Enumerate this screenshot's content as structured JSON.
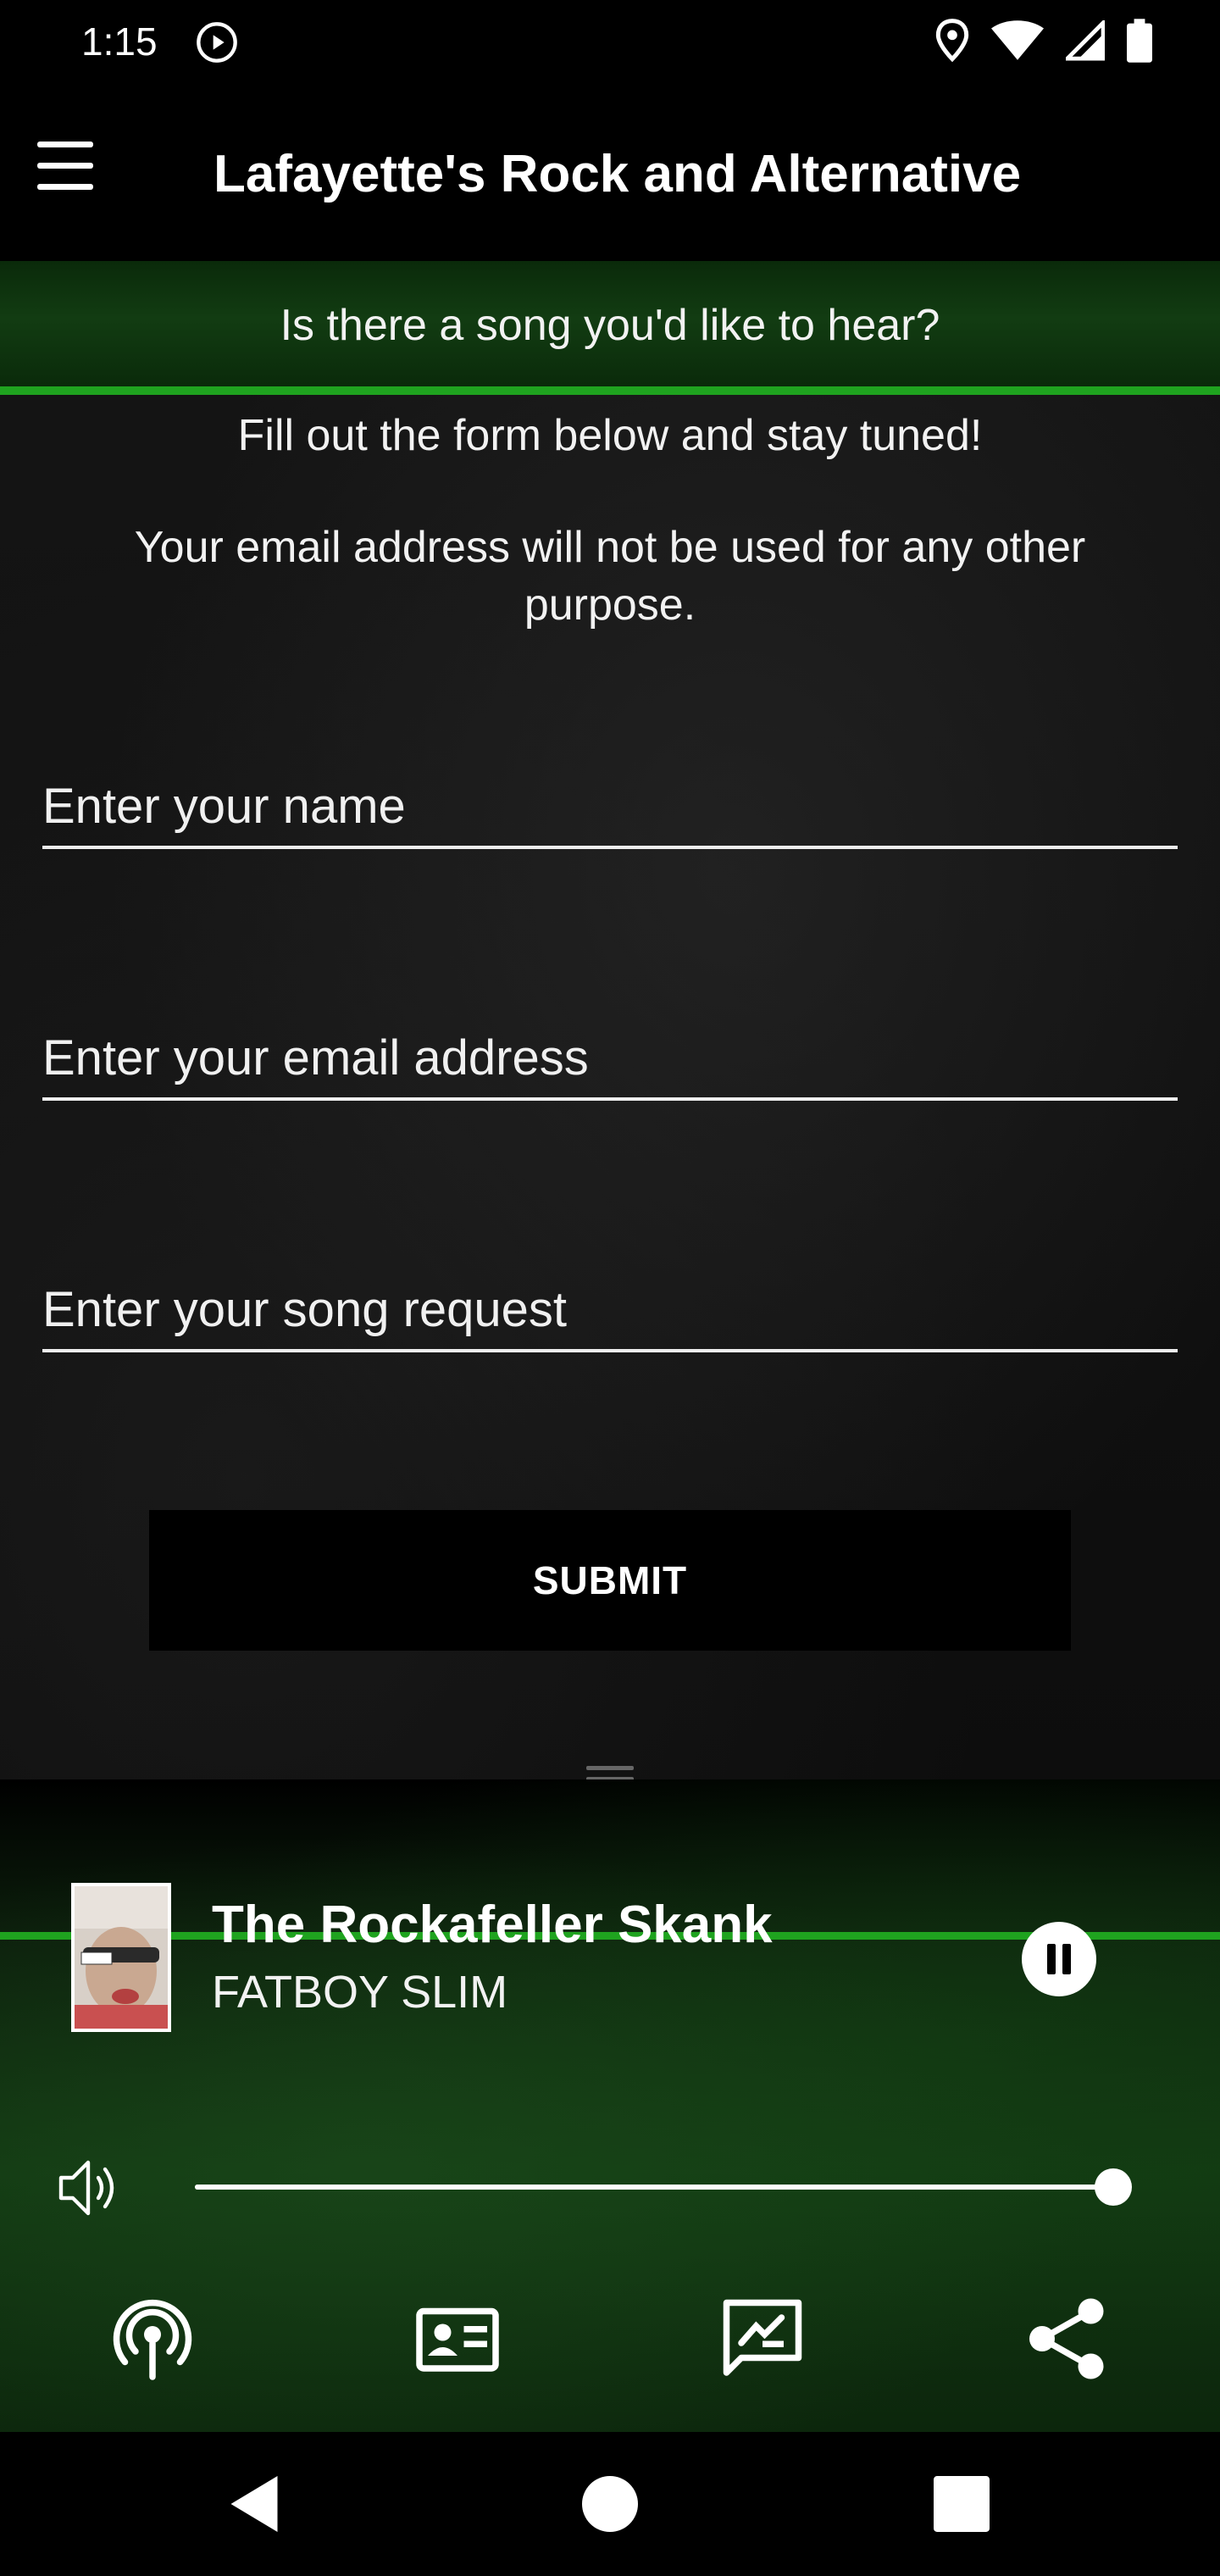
{
  "status_bar": {
    "time": "1:15",
    "left_icons": [
      "play-circle-icon"
    ],
    "right_icons": [
      "location-icon",
      "wifi-icon",
      "cell-signal-icon",
      "battery-icon"
    ]
  },
  "app_bar": {
    "menu_icon": "hamburger-menu-icon",
    "title": "Lafayette's Rock and Alternative"
  },
  "form": {
    "prompt": "Is there a song you'd like to hear?",
    "instruction": "Fill out the form below and stay tuned!",
    "privacy_note": "Your email address will not be used for any other purpose.",
    "name_placeholder": "Enter your name",
    "email_placeholder": "Enter your email address",
    "song_placeholder": "Enter your song request",
    "submit_label": "SUBMIT"
  },
  "player": {
    "track_title": "The Rockafeller Skank",
    "artist": "FATBOY SLIM",
    "state": "playing",
    "volume_level": 1.0,
    "accent_color": "#1fa31f",
    "actions": [
      "podcast-icon",
      "contact-card-icon",
      "feedback-icon",
      "share-icon"
    ]
  },
  "nav_bar": {
    "buttons": [
      "back-icon",
      "home-icon",
      "recents-icon"
    ]
  }
}
